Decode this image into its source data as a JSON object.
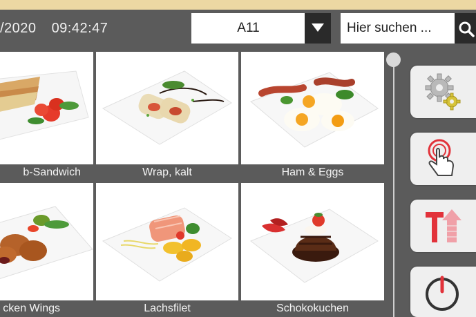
{
  "header": {
    "date": "/2020",
    "time": "09:42:47",
    "table_selector": {
      "value": "A11"
    },
    "search": {
      "placeholder": "Hier suchen ..."
    }
  },
  "menu": {
    "items": [
      {
        "label": "b-Sandwich"
      },
      {
        "label": "Wrap, kalt"
      },
      {
        "label": "Ham & Eggs"
      },
      {
        "label": "cken Wings"
      },
      {
        "label": "Lachsfilet"
      },
      {
        "label": "Schokokuchen"
      }
    ]
  },
  "sidebar": {
    "buttons": [
      {
        "icon": "settings-gears-icon"
      },
      {
        "icon": "touch-hand-icon"
      },
      {
        "icon": "text-size-icon"
      },
      {
        "icon": "power-icon"
      }
    ]
  },
  "colors": {
    "background": "#5b5b5b",
    "top_strip": "#ecd8a3",
    "accent_red": "#e2323a",
    "accent_pink": "#f0a0a8",
    "button_bg": "#efefef"
  }
}
